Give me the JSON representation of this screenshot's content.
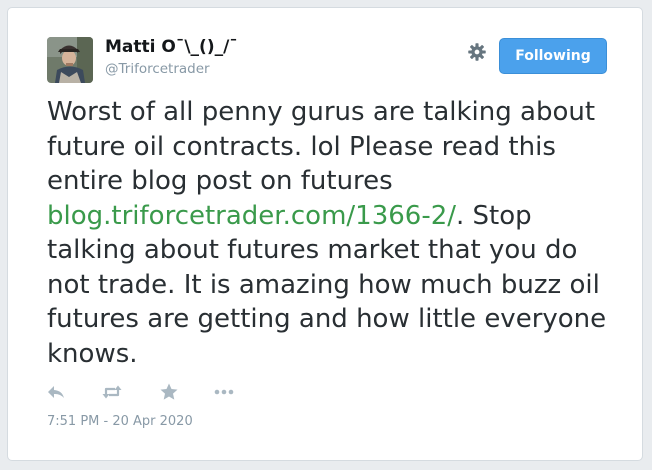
{
  "user": {
    "display_name": "Matti O¯\\_()_/¯",
    "handle": "@Triforcetrader"
  },
  "header": {
    "follow_button_label": "Following",
    "settings_icon": "gear-icon"
  },
  "tweet": {
    "text_before_link": "Worst of all penny gurus are talking about future oil contracts. lol Please read this entire blog post on futures ",
    "link_text": "blog.triforcetrader.com/1366-2/",
    "text_after_link": ". Stop talking about futures market that you do not trade. It is amazing how much buzz oil futures are getting and how little everyone knows."
  },
  "actions": [
    {
      "icon": "reply-icon"
    },
    {
      "icon": "retweet-icon"
    },
    {
      "icon": "favorite-star-icon"
    },
    {
      "icon": "more-dots-icon"
    }
  ],
  "timestamp": "7:51 PM - 20 Apr 2020",
  "colors": {
    "button": "#4ba1ec",
    "link": "#3a9a4b",
    "text": "#292f33",
    "muted": "#8899a6",
    "icon": "#aab8c2"
  }
}
